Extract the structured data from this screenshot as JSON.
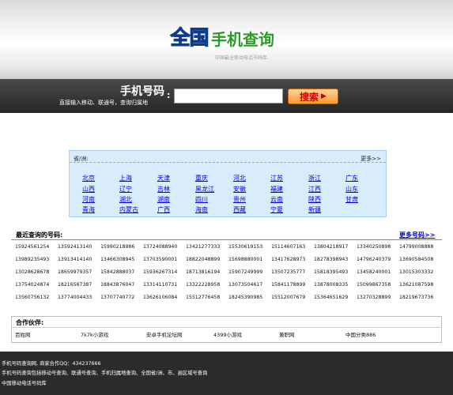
{
  "header": {
    "logo_mark": [
      "全",
      "国"
    ],
    "logo_text": "手机查询",
    "subtitle": "中国最全移动电话号码库"
  },
  "search": {
    "title": "手机号码",
    "colon": ":",
    "description": "直接输入移动、联通号，查询归属地",
    "input_value": "",
    "button_label": "搜索",
    "button_arrow": "▶"
  },
  "provinces": {
    "header": "省/洲:",
    "more": "更多>>",
    "rows": [
      [
        "北京",
        "上海",
        "天津",
        "重庆",
        "河北",
        "江苏",
        "浙江",
        "广东"
      ],
      [
        "山西",
        "辽宁",
        "吉林",
        "黑龙江",
        "安徽",
        "福建",
        "江西",
        "山东"
      ],
      [
        "河南",
        "湖北",
        "湖南",
        "四川",
        "贵州",
        "云南",
        "陕西",
        "甘肃"
      ],
      [
        "青海",
        "内蒙古",
        "广西",
        "海南",
        "西藏",
        "宁夏",
        "新疆"
      ]
    ]
  },
  "recent": {
    "title": "最近查询的号码:",
    "more": "更多号码>>",
    "rows": [
      [
        "15924561254",
        "13592413140",
        "15990218986",
        "13724088940",
        "13421277333",
        "15530619153",
        "15114607163",
        "13804218917",
        "13340250898",
        "14799008888"
      ],
      [
        "13989235493",
        "13913414140",
        "13466308945",
        "13703590001",
        "18822048899",
        "15698880001",
        "13417628973",
        "18278398943",
        "14796240379",
        "13690584508"
      ],
      [
        "13028628678",
        "18659979357",
        "15842888037",
        "15936267314",
        "18713816194",
        "15907249999",
        "13507235777",
        "15818395493",
        "13458240001",
        "13015303332"
      ],
      [
        "13754024874",
        "18216567387",
        "18843876047",
        "13314110731",
        "13322228958",
        "13073504617",
        "15841178899",
        "13878008335",
        "15099867358",
        "13621087598"
      ],
      [
        "13560756132",
        "13774004433",
        "13707740772",
        "13626106084",
        "15512776458",
        "18245390985",
        "15512007679",
        "15364651629",
        "13270328899",
        "18219673736"
      ]
    ]
  },
  "partners": {
    "title": "合作伙伴:",
    "items": [
      "百姓网",
      "7k7k小游戏",
      "安卓手机论坛网",
      "4399小游戏",
      "兼职网",
      "中国分类886"
    ]
  },
  "footer": {
    "lines": [
      "手机号码查询网, 商家合作QQ：434237666",
      "手机号码查询包括移动号查询、联通号查询、手机归属地查询、全国省/洲、市、县区域号查询",
      "中国移动电话号码库"
    ]
  }
}
